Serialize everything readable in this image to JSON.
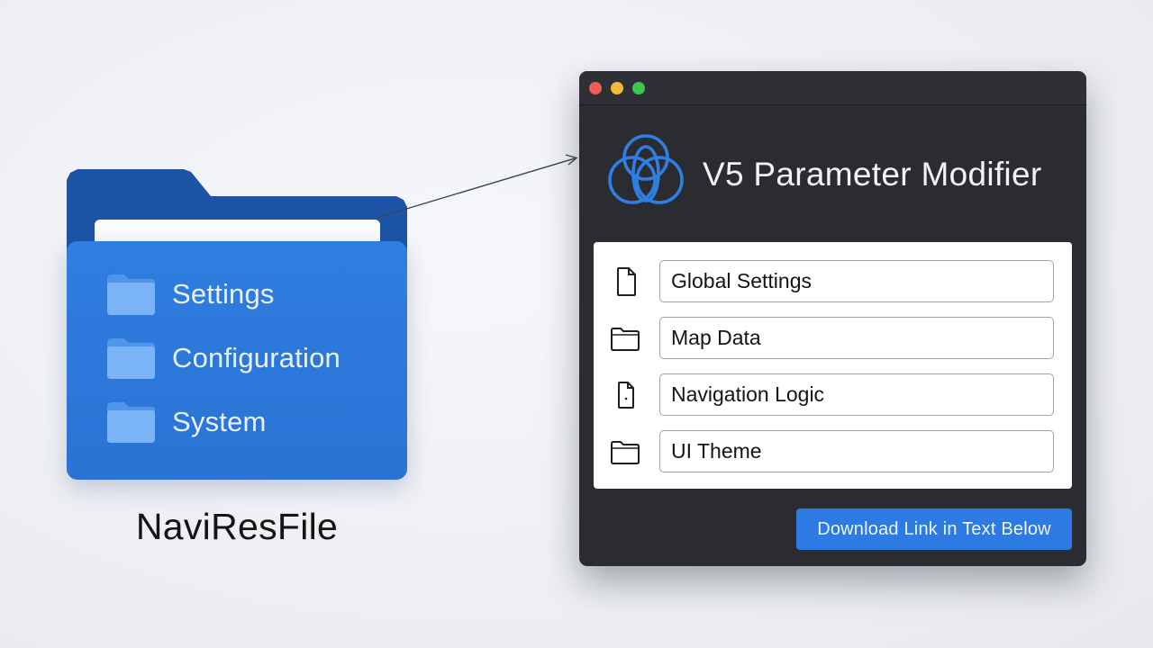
{
  "left_folder": {
    "items": [
      {
        "label": "Settings",
        "icon": "folder-icon"
      },
      {
        "label": "Configuration",
        "icon": "folder-icon"
      },
      {
        "label": "System",
        "icon": "folder-icon"
      }
    ],
    "caption": "NaviResFile"
  },
  "window": {
    "title": "V5 Parameter Modifier",
    "logo": "interlocking-rings-logo",
    "rows": [
      {
        "label": "Global Settings",
        "icon": "document-icon"
      },
      {
        "label": "Map Data",
        "icon": "folder-icon"
      },
      {
        "label": "Navigation Logic",
        "icon": "document-icon"
      },
      {
        "label": "UI Theme",
        "icon": "folder-icon"
      }
    ],
    "download_button": "Download Link in Text Below"
  },
  "colors": {
    "folder_front": "#2a73d5",
    "folder_back": "#1d54a6",
    "window_bg": "#2a2c31",
    "accent": "#2d7be2"
  }
}
